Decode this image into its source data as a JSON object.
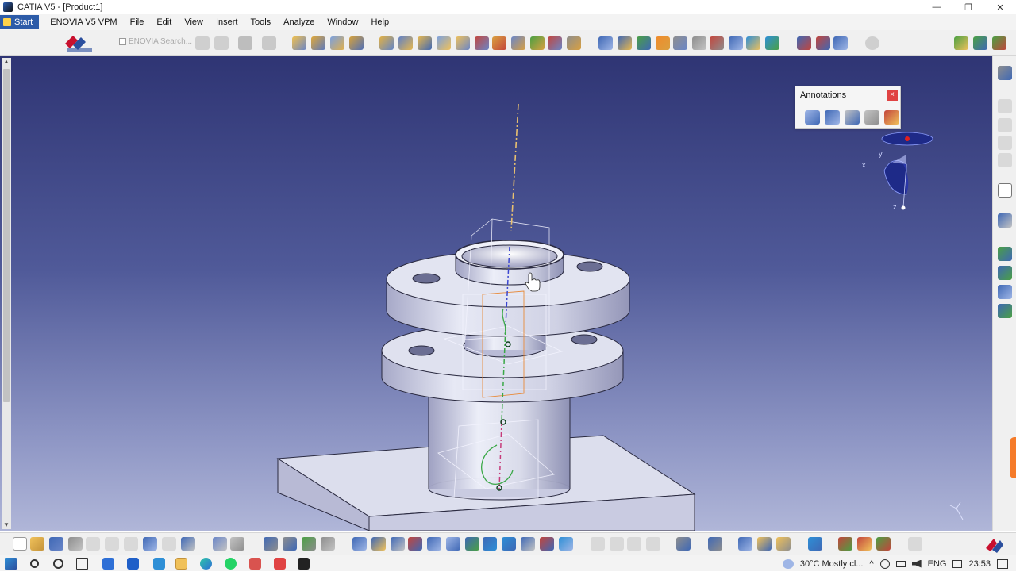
{
  "window": {
    "title": "CATIA V5 - [Product1]",
    "controls": [
      "—",
      "❐",
      "✕"
    ],
    "mdi_controls": [
      "–",
      "▫",
      "✕"
    ]
  },
  "menubar": {
    "start": "Start",
    "items": [
      "ENOVIA V5 VPM",
      "File",
      "Edit",
      "View",
      "Insert",
      "Tools",
      "Analyze",
      "Window",
      "Help"
    ]
  },
  "toolbar": {
    "search_label": "ENOVIA Search..."
  },
  "annotations_panel": {
    "title": "Annotations",
    "close": "×"
  },
  "compass": {
    "x": "x",
    "y": "y",
    "z": "z"
  },
  "taskbar": {
    "weather": "30°C  Mostly cl...",
    "language": "ENG",
    "time": "23:53"
  },
  "colors": {
    "accent": "#2d5ca8",
    "viewport_top": "#2f3574",
    "viewport_bottom": "#b0b6d8",
    "close_red": "#e04343"
  }
}
